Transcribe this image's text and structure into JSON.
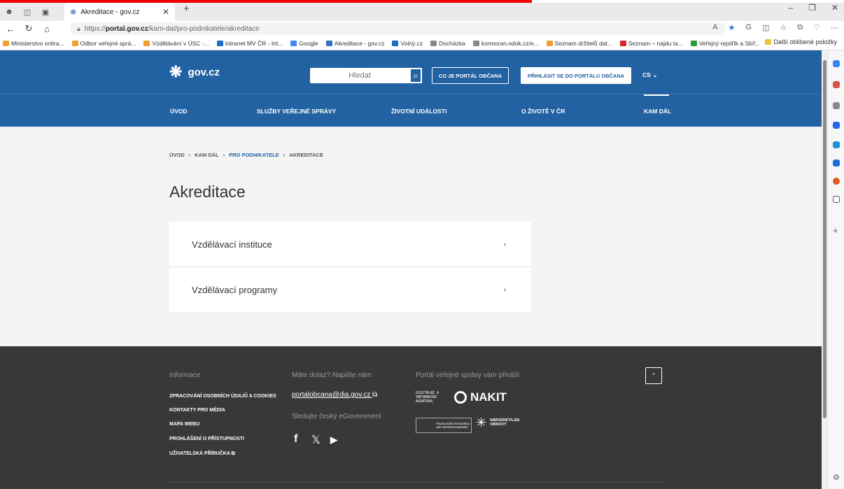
{
  "browser": {
    "tab_title": "Akreditace - gov.cz",
    "url_prefix": "https://",
    "url_domain": "portal.gov.cz",
    "url_path": "/kam-dal/pro-podnikatele/akreditace",
    "bookmarks": [
      {
        "label": "Ministerstvo vnitra...",
        "color": "#f0a030"
      },
      {
        "label": "Odbor veřejné sprá...",
        "color": "#f0a030"
      },
      {
        "label": "Vzdělávání v ÚSC -...",
        "color": "#f0a030"
      },
      {
        "label": "Intranet MV ČR - Int...",
        "color": "#1e6cc8"
      },
      {
        "label": "Google",
        "color": "#4285f4"
      },
      {
        "label": "Akreditace - gov.cz",
        "color": "#2f72b7"
      },
      {
        "label": "Volný.cz",
        "color": "#1e6cc8"
      },
      {
        "label": "Docházka",
        "color": "#888888"
      },
      {
        "label": "kormoran.odok.cz/e...",
        "color": "#888888"
      },
      {
        "label": "Seznam držitelů dat...",
        "color": "#f0a030"
      },
      {
        "label": "Seznam – najdu ta...",
        "color": "#d8262b"
      },
      {
        "label": "Veřejný rejstřík a Sbí...",
        "color": "#2e9b3e"
      }
    ],
    "bookmarks_more": "Další oblíbené položky"
  },
  "header": {
    "logo_text": "gov.cz",
    "search_placeholder": "Hledat",
    "btn_portal": "CO JE PORTÁL OBČANA",
    "btn_login": "PŘIHLÁSIT SE DO PORTÁLU OBČANA",
    "lang": "CS"
  },
  "menu": {
    "items": [
      "ÚVOD",
      "SLUŽBY VEŘEJNÉ SPRÁVY",
      "ŽIVOTNÍ UDÁLOSTI",
      "O ŽIVOTĚ V ČR",
      "KAM DÁL"
    ]
  },
  "breadcrumb": [
    "ÚVOD",
    "KAM DÁL",
    "PRO PODNIKATELE",
    "AKREDITACE"
  ],
  "page": {
    "title": "Akreditace",
    "cards": [
      "Vzdělávací instituce",
      "Vzdělávací programy"
    ]
  },
  "footer": {
    "info_head": "Informace",
    "links": [
      "ZPRACOVÁNÍ OSOBNÍCH ÚDAJŮ A COOKIES",
      "KONTAKTY PRO MÉDIA",
      "MAPA WEBU",
      "PROHLÁŠENÍ O PŘÍSTUPNOSTI",
      "UŽIVATELSKÁ PŘÍRUČKA"
    ],
    "question_head": "Máte dotaz? Napište nám",
    "email": "portalobcana@dia.gov.cz",
    "follow_head": "Sledujte český eGovernment",
    "brought_head": "Portál veřejné správy vám přináší",
    "dia_logo": "DIGITÁLNÍ A INFORMAČNÍ AGENTURA_",
    "nakit_logo": "NAKIT",
    "eu_logo": "Financováno Evropskou unií NextGenerationEU",
    "npo_logo": "NÁRODNÍ PLÁN OBNOVY"
  }
}
